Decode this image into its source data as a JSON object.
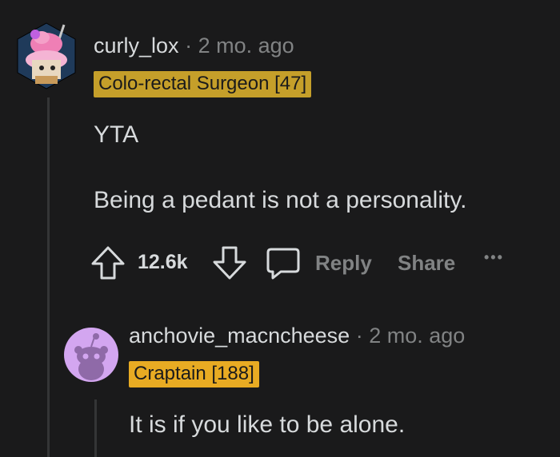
{
  "comment1": {
    "username": "curly_lox",
    "separator": "·",
    "time": "2 mo. ago",
    "flair": "Colo-rectal Surgeon [47]",
    "paragraphs": [
      "YTA",
      "Being a pedant is not a personality."
    ],
    "actions": {
      "score": "12.6k",
      "reply_label": "Reply",
      "share_label": "Share",
      "more_label": "•••"
    }
  },
  "comment2": {
    "username": "anchovie_macncheese",
    "separator": "·",
    "time": "2 mo. ago",
    "flair": "Craptain [188]",
    "paragraphs": [
      "It is if you like to be alone."
    ]
  },
  "icons": {
    "upvote": "arrow-up-outline",
    "downvote": "arrow-down-outline",
    "reply": "speech-bubble",
    "avatar1": "ice-cream-snoo",
    "avatar2": "default-snoo"
  },
  "colors": {
    "background": "#1a1a1b",
    "text": "#d7dadc",
    "muted": "#818384",
    "flair1": "#c59f2a",
    "flair2": "#e8ab23",
    "avatar2_bg": "#d3a6f0"
  }
}
